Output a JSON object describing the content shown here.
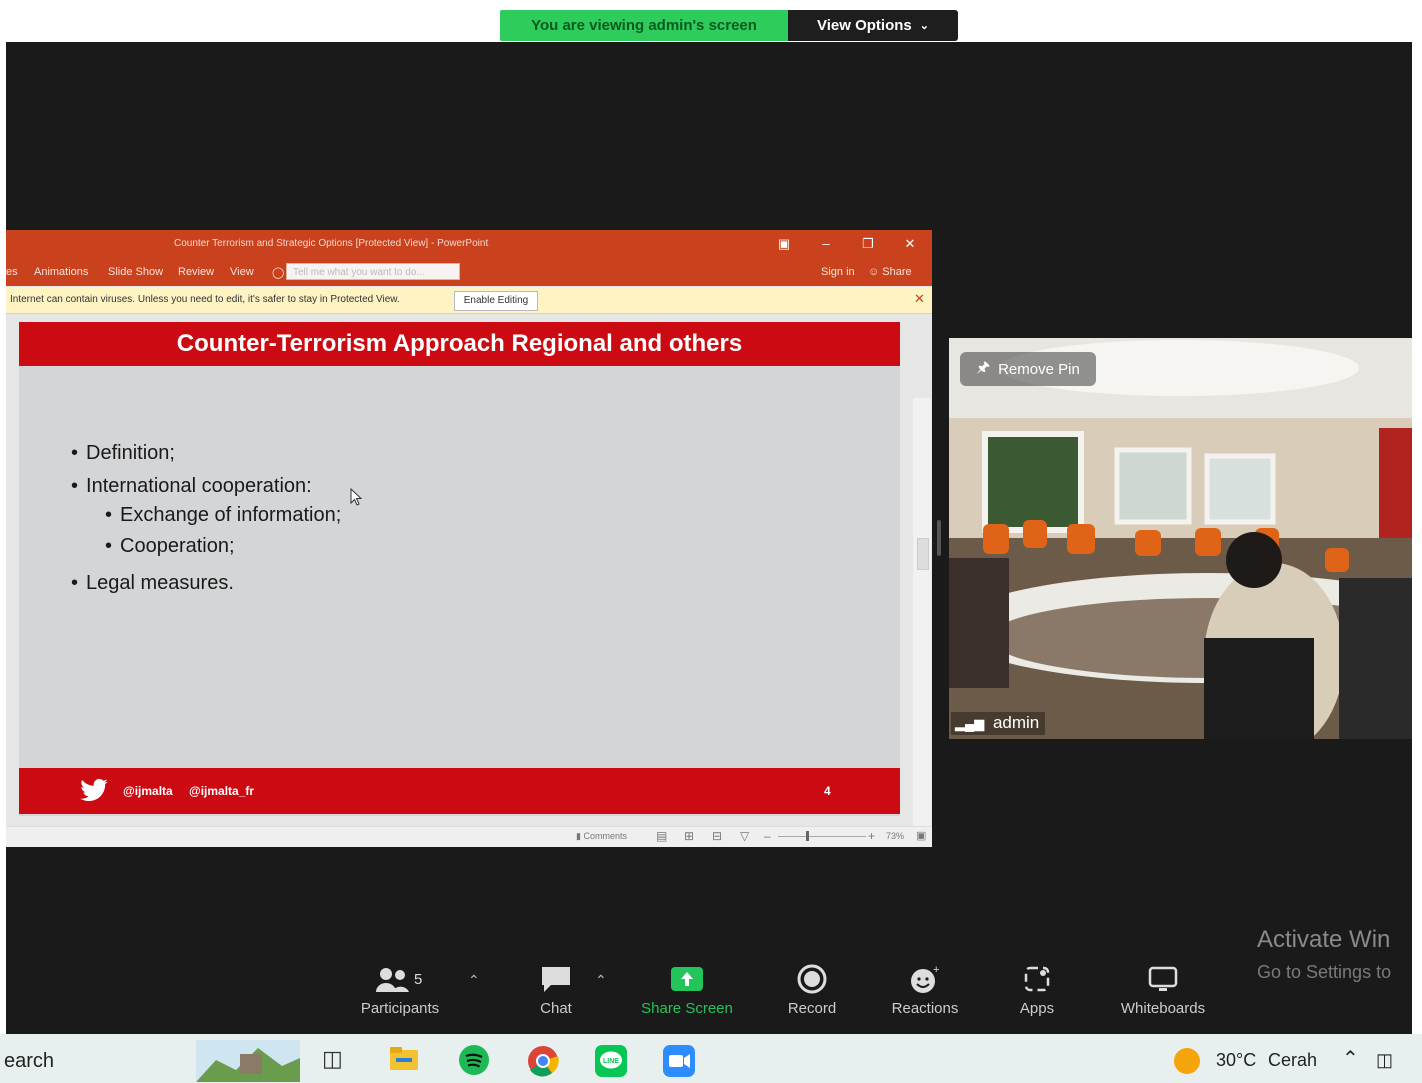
{
  "zoom_banner": {
    "viewing_text": "You are viewing admin's screen",
    "view_options_label": "View Options"
  },
  "ppt": {
    "window_title": "Counter Terrorism and Strategic Options [Protected View] - PowerPoint",
    "menu": [
      "es",
      "Animations",
      "Slide Show",
      "Review",
      "View"
    ],
    "tell_me_placeholder": "Tell me what you want to do...",
    "sign_in": "Sign in",
    "share": "Share",
    "protected_message": "Internet can contain viruses. Unless you need to edit, it's safer to stay in Protected View.",
    "enable_editing": "Enable Editing",
    "status_comments": "Comments",
    "zoom_level": "73%"
  },
  "slide": {
    "title": "Counter-Terrorism Approach Regional and others",
    "bullets": [
      "Definition;",
      "International cooperation:",
      "Exchange of information;",
      "Cooperation;",
      "Legal measures."
    ],
    "handle_1": "@ijmalta",
    "handle_2": "@ijmalta_fr",
    "page_number": "4"
  },
  "video": {
    "remove_pin": "Remove Pin",
    "participant_name": "admin"
  },
  "toolbar": {
    "participants_label": "Participants",
    "participants_count": "5",
    "chat_label": "Chat",
    "share_screen_label": "Share Screen",
    "record_label": "Record",
    "reactions_label": "Reactions",
    "apps_label": "Apps",
    "whiteboards_label": "Whiteboards"
  },
  "watermark": {
    "line1": "Activate Win",
    "line2": "Go to Settings to"
  },
  "taskbar": {
    "search_text": "earch",
    "temperature": "30°C",
    "weather": "Cerah"
  },
  "colors": {
    "zoom_bg": "#1a1a1a",
    "ppt_accent": "#c9421d",
    "slide_red": "#cc0a12",
    "share_green": "#23c45a"
  }
}
